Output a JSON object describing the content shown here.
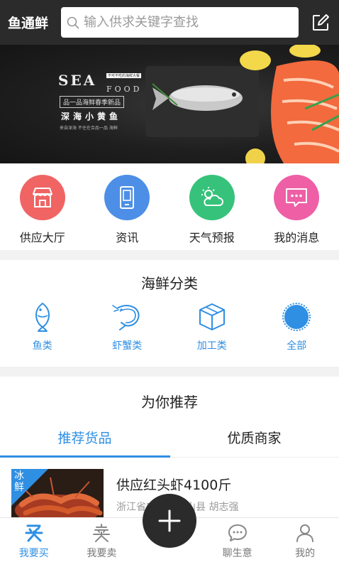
{
  "header": {
    "brand": "鱼通鲜",
    "search_placeholder": "输入供求关键字查找"
  },
  "banner": {
    "sea": "SEA",
    "food": "FOOD",
    "tag": "不可不吃的海鲜大餐",
    "line1": "品一品海鲜春季新品",
    "line2": "深海小黄鱼",
    "line3": "来自深海 不住在合品一品 海鲜"
  },
  "quick_nav": [
    {
      "label": "供应大厅",
      "icon": "storefront-icon",
      "color": "#f06464"
    },
    {
      "label": "资讯",
      "icon": "phone-icon",
      "color": "#4d8fe6"
    },
    {
      "label": "天气预报",
      "icon": "weather-icon",
      "color": "#36c27a"
    },
    {
      "label": "我的消息",
      "icon": "message-icon",
      "color": "#ee5fa6"
    }
  ],
  "category": {
    "title": "海鲜分类",
    "items": [
      {
        "label": "鱼类",
        "icon": "fish-icon"
      },
      {
        "label": "虾蟹类",
        "icon": "shrimp-icon"
      },
      {
        "label": "加工类",
        "icon": "box-icon"
      },
      {
        "label": "全部",
        "icon": "all-icon"
      }
    ]
  },
  "recommend": {
    "title": "为你推荐",
    "tabs": [
      "推荐货品",
      "优质商家"
    ],
    "active_tab": 0,
    "product": {
      "badge": "冰鲜",
      "title": "供应红头虾4100斤",
      "meta": "浙江省宁波市象山县  胡志强"
    }
  },
  "bottom_nav": [
    {
      "label": "我要买",
      "icon": "buy-icon",
      "active": true
    },
    {
      "label": "我要卖",
      "icon": "sell-icon",
      "active": false
    },
    {
      "label": "聊生意",
      "icon": "chat-icon",
      "active": false
    },
    {
      "label": "我的",
      "icon": "user-icon",
      "active": false
    }
  ],
  "colors": {
    "accent": "#2f8fe3",
    "header_bg": "#2b2b2b"
  }
}
